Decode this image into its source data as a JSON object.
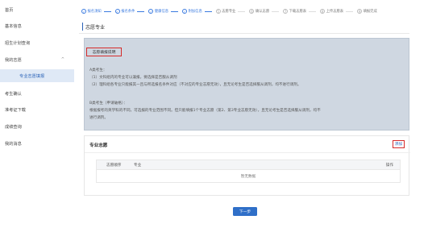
{
  "sidebar": {
    "items": [
      {
        "label": "首页"
      },
      {
        "label": "基本信息"
      },
      {
        "label": "招生计划查询"
      },
      {
        "label": "我的志愿",
        "chevron": "^"
      },
      {
        "label": "专业志愿填报"
      },
      {
        "label": "考生确认"
      },
      {
        "label": "准考证下载"
      },
      {
        "label": "成绩查询"
      },
      {
        "label": "我的消息"
      }
    ]
  },
  "stepper": {
    "steps": [
      {
        "num": "1",
        "label": "报名须知",
        "done": true
      },
      {
        "num": "2",
        "label": "报名条件",
        "done": true
      },
      {
        "num": "3",
        "label": "健康信息",
        "done": true
      },
      {
        "num": "4",
        "label": "附加信息",
        "done": true
      },
      {
        "num": "5",
        "label": "志愿专业",
        "done": false
      },
      {
        "num": "6",
        "label": "确认志愿",
        "done": false
      },
      {
        "num": "7",
        "label": "下载志愿表",
        "done": false
      },
      {
        "num": "8",
        "label": "上传志愿表",
        "done": false
      },
      {
        "num": "9",
        "label": "填报完成",
        "done": false
      }
    ]
  },
  "page": {
    "title": "志愿专业"
  },
  "notice": {
    "title": "志愿填报说明",
    "lines": [
      "A类考生：",
      "（1）文科组内的专业可以兼报，要选择是否服从调剂",
      "（2）理科组各专业只能报其一且与所选报名条件对应（不对应的专业志愿无效），且无论考生是否选择服从调剂，均不进行调剂。",
      "B类考生（申请破格）：",
      "根据报考的英学科的不同，可选报的专业范围不同。但只能填报1个专业志愿（第2、第3专业志愿无效），且无论考生是否选择服从调剂，均不",
      "进行调剂。"
    ]
  },
  "choices": {
    "title": "专业志愿",
    "add_label": "添加",
    "table": {
      "headers": [
        "志愿顺序",
        "专业",
        "操作"
      ],
      "empty_text": "暂无数据"
    }
  },
  "actions": {
    "next_label": "下一步"
  },
  "colors": {
    "accent": "#2b63b8",
    "highlight_border": "#d52a2a",
    "notice_bg": "#cfd7e1",
    "active_item_bg": "#dfe9f6"
  }
}
